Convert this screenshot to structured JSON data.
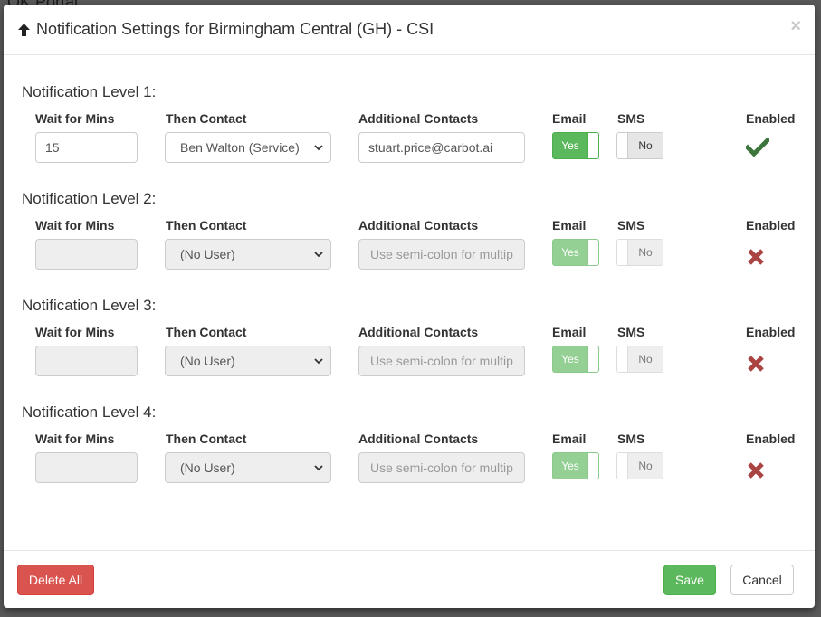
{
  "background": {
    "partial_text": "OK Portal"
  },
  "header": {
    "title": "Notification Settings for Birmingham Central (GH) - CSI",
    "close_symbol": "×"
  },
  "columns": {
    "wait": "Wait for Mins",
    "contact": "Then Contact",
    "additional": "Additional Contacts",
    "email": "Email",
    "sms": "SMS",
    "enabled": "Enabled"
  },
  "levels": [
    {
      "title": "Notification Level 1:",
      "wait_value": "15",
      "contact": "Ben Walton (Service)",
      "additional_value": "stuart.price@carbot.ai",
      "additional_placeholder": "",
      "email": "Yes",
      "sms": "No",
      "enabled": true
    },
    {
      "title": "Notification Level 2:",
      "wait_value": "",
      "contact": "(No User)",
      "additional_value": "",
      "additional_placeholder": "Use semi-colon for multip",
      "email": "Yes",
      "sms": "No",
      "enabled": false
    },
    {
      "title": "Notification Level 3:",
      "wait_value": "",
      "contact": "(No User)",
      "additional_value": "",
      "additional_placeholder": "Use semi-colon for multip",
      "email": "Yes",
      "sms": "No",
      "enabled": false
    },
    {
      "title": "Notification Level 4:",
      "wait_value": "",
      "contact": "(No User)",
      "additional_value": "",
      "additional_placeholder": "Use semi-colon for multip",
      "email": "Yes",
      "sms": "No",
      "enabled": false
    }
  ],
  "footer": {
    "delete_all": "Delete All",
    "save": "Save",
    "cancel": "Cancel"
  },
  "colors": {
    "success": "#5cb85c",
    "danger": "#d9534f",
    "check": "#3c763d",
    "cross": "#a94442"
  }
}
